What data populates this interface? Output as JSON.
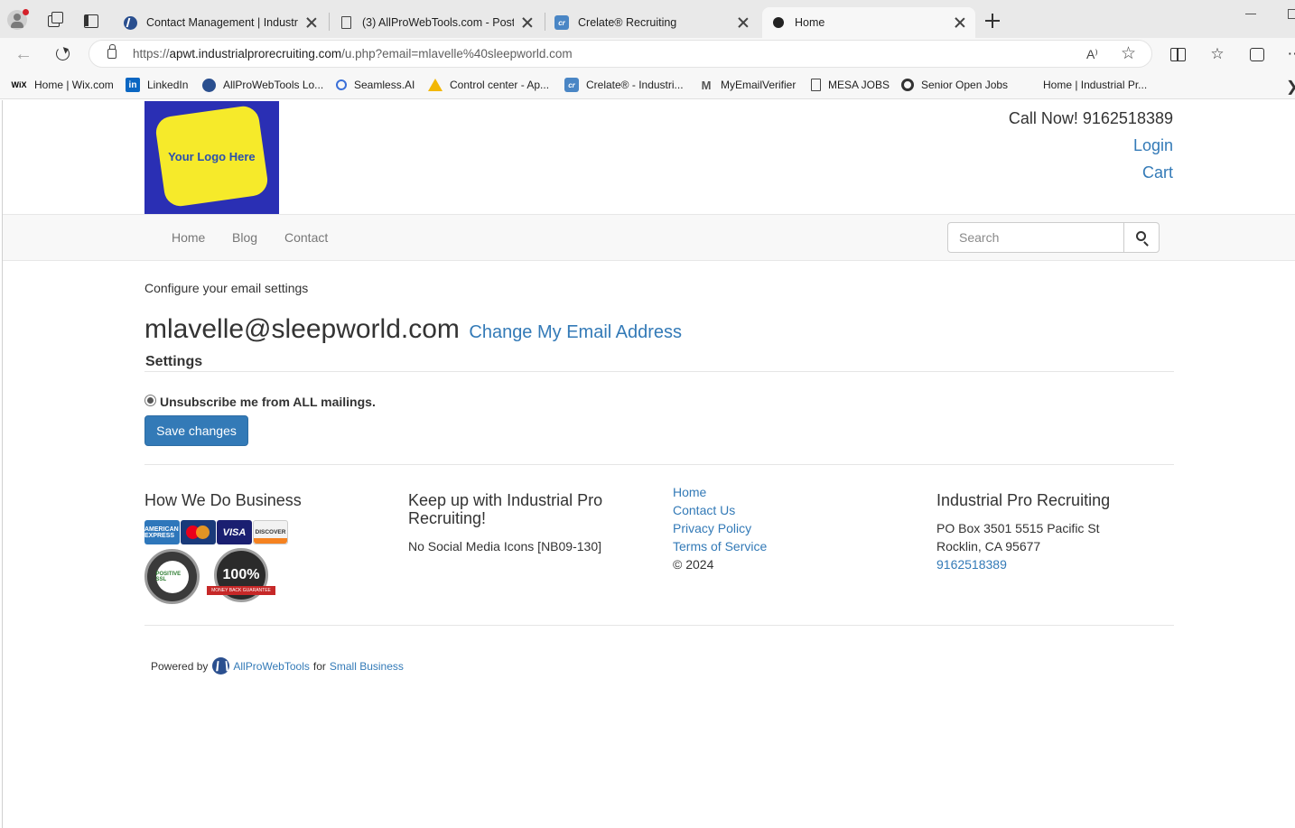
{
  "browser": {
    "tabs": [
      {
        "title": "Contact Management | Industrial",
        "favicon": "globe-icon",
        "active": false
      },
      {
        "title": "(3) AllProWebTools.com - Post a",
        "favicon": "document-icon",
        "active": false
      },
      {
        "title": "Crelate® Recruiting",
        "favicon": "crelate-icon",
        "active": false
      },
      {
        "title": "Home",
        "favicon": "github-icon",
        "active": true
      }
    ],
    "url_prefix": "https://",
    "url_host": "apwt.industrialprorecruiting.com",
    "url_path": "/u.php?email=mlavelle%40sleepworld.com",
    "read_aloud": "A⁾",
    "bookmarks": [
      {
        "label": "Home | Wix.com",
        "icon": "wix-icon"
      },
      {
        "label": "LinkedIn",
        "icon": "linkedin-icon"
      },
      {
        "label": "AllProWebTools Lo...",
        "icon": "globe-icon"
      },
      {
        "label": "Seamless.AI",
        "icon": "search-icon"
      },
      {
        "label": "Control center - Ap...",
        "icon": "warning-icon"
      },
      {
        "label": "Crelate® - Industri...",
        "icon": "crelate-icon"
      },
      {
        "label": "MyEmailVerifier",
        "icon": "m-icon"
      },
      {
        "label": "MESA JOBS",
        "icon": "document-icon"
      },
      {
        "label": "Senior Open Jobs",
        "icon": "ring-icon"
      },
      {
        "label": "Home | Industrial Pr...",
        "icon": "none"
      }
    ]
  },
  "header": {
    "logo_text": "Your Logo Here",
    "call_now": "Call Now! 9162518389",
    "login": "Login",
    "cart": "Cart"
  },
  "nav": {
    "items": [
      "Home",
      "Blog",
      "Contact"
    ],
    "search_placeholder": "Search"
  },
  "main": {
    "configure_text": "Configure your email settings",
    "email": "mlavelle@sleepworld.com",
    "change_email": "Change My Email Address",
    "settings_heading": "Settings",
    "unsubscribe_label": "Unsubscribe me from ALL mailings.",
    "save_button": "Save changes"
  },
  "footer": {
    "col1": {
      "heading": "How We Do Business",
      "cards": [
        "AMERICAN EXPRESS",
        "MasterCard",
        "VISA",
        "DISCOVER"
      ],
      "ssl_seal": "POSITIVE SSL",
      "guarantee_seal": "100%",
      "guarantee_ribbon": "MONEY BACK GUARANTEE"
    },
    "col2": {
      "heading": "Keep up with Industrial Pro Recruiting!",
      "text": "No Social Media Icons [NB09-130]"
    },
    "col3": {
      "links": [
        "Home",
        "Contact Us",
        "Privacy Policy",
        "Terms of Service"
      ],
      "copyright": "© 2024"
    },
    "col4": {
      "heading": "Industrial Pro Recruiting",
      "address1": "PO Box 3501 5515 Pacific St",
      "address2": "Rocklin, CA 95677",
      "phone": "9162518389"
    }
  },
  "powered": {
    "prefix": "Powered by",
    "brand": "AllProWebTools",
    "middle": "for",
    "suffix": "Small Business"
  },
  "colors": {
    "link": "#337ab7",
    "button": "#337ab7",
    "logo_bg": "#2a2fb4",
    "logo_fg": "#f6ea2a"
  }
}
